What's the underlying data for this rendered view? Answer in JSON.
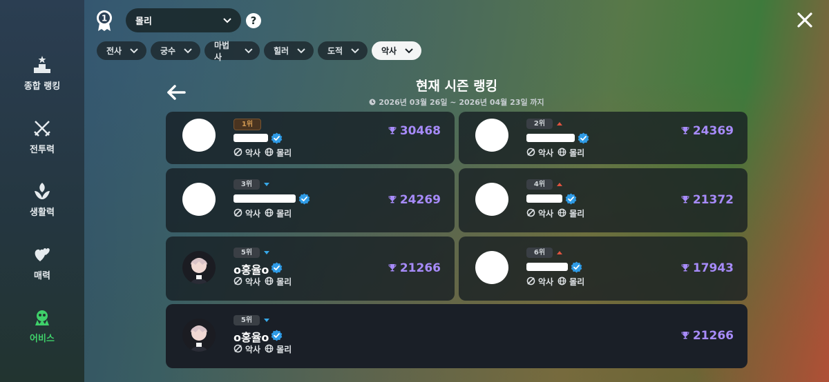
{
  "sidebar": {
    "items": [
      {
        "label": "종합 랭킹",
        "icon": "podium-icon",
        "active": false
      },
      {
        "label": "전투력",
        "icon": "crossed-swords-icon",
        "active": false
      },
      {
        "label": "생활력",
        "icon": "sprout-hand-icon",
        "active": false
      },
      {
        "label": "매력",
        "icon": "hearts-icon",
        "active": false
      },
      {
        "label": "어비스",
        "icon": "abyss-icon",
        "active": true
      }
    ]
  },
  "header": {
    "server": "몰리",
    "help": "?",
    "filters": [
      {
        "label": "전사",
        "active": false
      },
      {
        "label": "궁수",
        "active": false
      },
      {
        "label": "마법사",
        "active": false
      },
      {
        "label": "힐러",
        "active": false
      },
      {
        "label": "도적",
        "active": false
      },
      {
        "label": "악사",
        "active": true
      }
    ]
  },
  "ranking": {
    "title": "현재 시즌 랭킹",
    "period": "2026년 03월 26일 ~ 2026년 04월 23일 까지",
    "entries": [
      {
        "rank": "1위",
        "name": "",
        "job": "악사",
        "server": "몰리",
        "score": "30468",
        "trend": "none"
      },
      {
        "rank": "2위",
        "name": "",
        "job": "악사",
        "server": "몰리",
        "score": "24369",
        "trend": "up"
      },
      {
        "rank": "3위",
        "name": "",
        "job": "악사",
        "server": "몰리",
        "score": "24269",
        "trend": "down"
      },
      {
        "rank": "4위",
        "name": "",
        "job": "악사",
        "server": "몰리",
        "score": "21372",
        "trend": "up"
      },
      {
        "rank": "5위",
        "name": "o홍율o",
        "job": "악사",
        "server": "몰리",
        "score": "21266",
        "trend": "down"
      },
      {
        "rank": "6위",
        "name": "",
        "job": "악사",
        "server": "몰리",
        "score": "17943",
        "trend": "up"
      }
    ],
    "mine": {
      "rank": "5위",
      "name": "o홍율o",
      "job": "악사",
      "server": "몰리",
      "score": "21266",
      "trend": "down"
    }
  },
  "colors": {
    "accent_active": "#3fd16a",
    "score": "#a78bfa",
    "trend_up": "#e0533f",
    "trend_down": "#37a8e8"
  }
}
